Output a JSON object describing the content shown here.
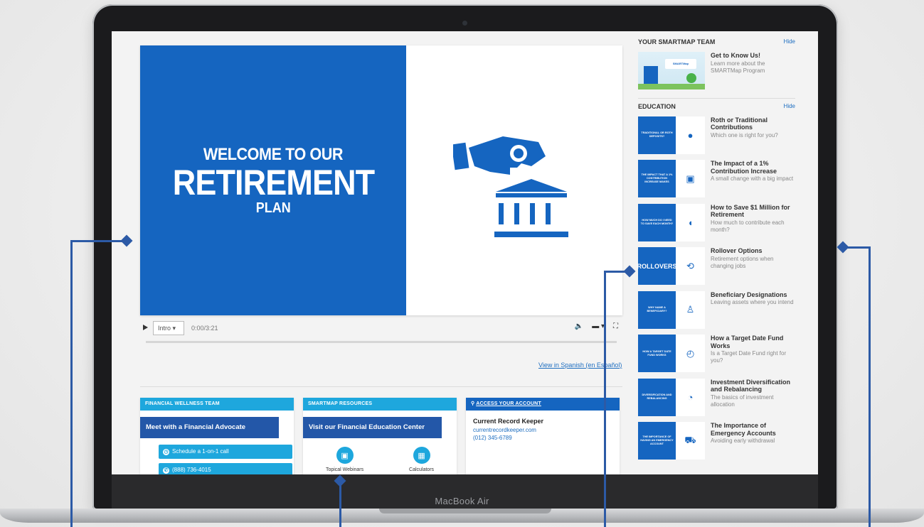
{
  "device": {
    "label": "MacBook Air"
  },
  "video": {
    "title_line1": "WELCOME TO OUR",
    "title_line2": "RETIREMENT",
    "title_line3": "PLAN",
    "chapter": "Intro",
    "timecode": "0:00/3:21",
    "spanish_link": "View in Spanish (en Español)"
  },
  "cards": {
    "wellness": {
      "header": "FINANCIAL WELLNESS TEAM",
      "button": "Meet with a Financial Advocate",
      "schedule": "Schedule a 1-on-1 call",
      "phone": "(888) 736-4015"
    },
    "resources": {
      "header": "SMARTMAP RESOURCES",
      "button": "Visit our Financial Education Center",
      "topical": "Topical Webinars",
      "calculators": "Calculators"
    },
    "account": {
      "header": "ACCESS YOUR ACCOUNT",
      "keeper": "Current Record Keeper",
      "url": "currentrecordkeeper.com",
      "phone": "(012) 345-6789"
    }
  },
  "sidebar": {
    "team_title": "YOUR SMARTMAP TEAM",
    "hide": "Hide",
    "team_item": {
      "title": "Get to Know Us!",
      "desc": "Learn more about the SMARTMap Program",
      "sign": "SMARTMap"
    },
    "education_title": "EDUCATION",
    "items": [
      {
        "thumb": "TRADITIONAL OR ROTH DEPOSITS?",
        "title": "Roth or Traditional Contributions",
        "desc": "Which one is right for you?",
        "icon": "speech-bubble-icon"
      },
      {
        "thumb": "THE IMPACT THAT A 1% CONTRIBUTION INCREASE MAKES",
        "title": "The Impact of a 1% Contribution Increase",
        "desc": "A small change with a big impact",
        "icon": "briefcase-icon"
      },
      {
        "thumb": "HOW MUCH DO I NEED TO SAVE EACH MONTH?",
        "title": "How to Save $1 Million for Retirement",
        "desc": "How much to contribute each month?",
        "icon": "piggy-bank-icon"
      },
      {
        "thumb": "ROLLOVERS",
        "title": "Rollover Options",
        "desc": "Retirement options when changing jobs",
        "icon": "rollover-arrows-icon"
      },
      {
        "thumb": "WHY NAME A BENEFICIARY?",
        "title": "Beneficiary Designations",
        "desc": "Leaving assets where you intend",
        "icon": "person-icon"
      },
      {
        "thumb": "HOW A TARGET DATE FUND WORKS",
        "title": "How a Target Date Fund Works",
        "desc": "Is a Target Date Fund right for you?",
        "icon": "clock-icon"
      },
      {
        "thumb": "DIVERSIFICATION AND REBALANCING",
        "title": "Investment Diversification and Rebalancing",
        "desc": "The basics of investment allocation",
        "icon": "pie-chart-scale-icon"
      },
      {
        "thumb": "THE IMPORTANCE OF HAVING AN EMERGENCY ACCOUNT",
        "title": "The Importance of Emergency Accounts",
        "desc": "Avoiding early withdrawal",
        "icon": "money-truck-icon"
      }
    ]
  },
  "colors": {
    "brand_blue": "#1565c0",
    "accent_cyan": "#1ea7dd",
    "button_blue": "#2357a8",
    "annotation": "#2c5aa6"
  }
}
